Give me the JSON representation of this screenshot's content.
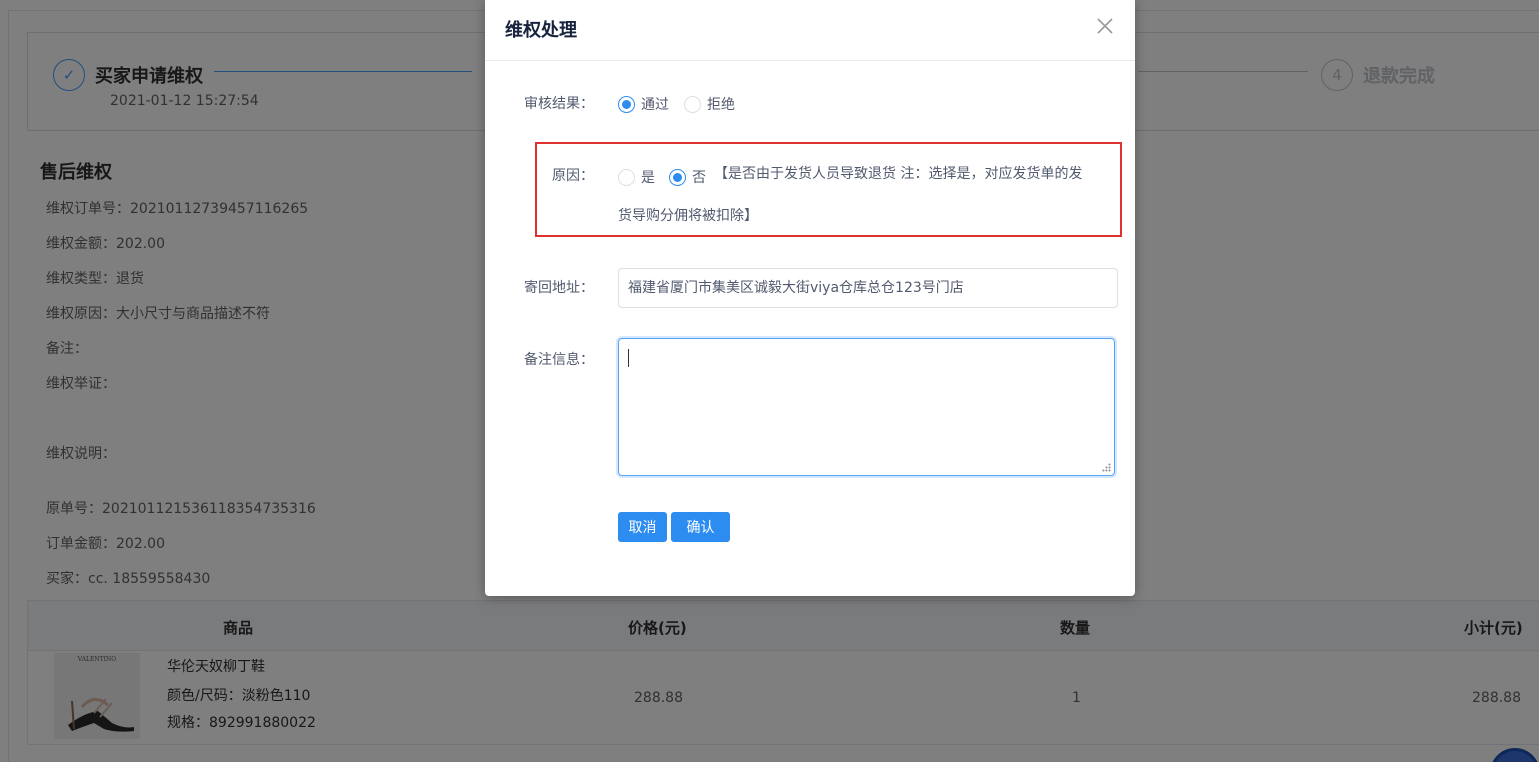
{
  "steps": [
    {
      "num": "✓",
      "title": "买家申请维权",
      "date": "2021-01-12 15:27:54",
      "state": "done"
    },
    {
      "num": "4",
      "title": "退款完成",
      "state": "wait"
    }
  ],
  "section_title": "售后维权",
  "info": {
    "order_no": "维权订单号：20210112739457116265",
    "amount": "维权金额：202.00",
    "type": "维权类型：退货",
    "reason": "维权原因：大小尺寸与商品描述不符",
    "remark": "备注：",
    "evidence": "维权举证：",
    "explain": "维权说明：",
    "orig_order": "原单号：20210112153611835473531​6",
    "order_amount": "订单金额：202.00",
    "buyer": "买家：cc. 18559558430"
  },
  "table": {
    "headers": {
      "goods": "商品",
      "price": "价格(元)",
      "qty": "数量",
      "subtotal": "小计(元)"
    },
    "row": {
      "name": "华伦天奴柳丁鞋",
      "spec_color": "颜色/尺码：淡粉色110",
      "spec_code": "规格：892991880022",
      "price": "288.88",
      "qty": "1",
      "subtotal": "288.88",
      "img_brand": "VALENTINO"
    }
  },
  "dialog": {
    "title": "维权处理",
    "audit_label": "审核结果：",
    "audit_options": [
      "通过",
      "拒绝"
    ],
    "audit_selected": "通过",
    "reason_label": "原因：",
    "reason_options": [
      "是",
      "否"
    ],
    "reason_selected": "否",
    "reason_note_1": "【是否由于发货人员导致退货 注：选择是，对应发货单的发",
    "reason_note_2": "货导购分佣将被扣除】",
    "address_label": "寄回地址：",
    "address_value": "福建省厦门市集美区诚毅大街viya仓库总仓123号门店",
    "remark_label": "备注信息：",
    "remark_value": "",
    "cancel_label": "取消",
    "confirm_label": "确认"
  },
  "colors": {
    "primary": "#2d8cf0",
    "highlight": "#e03131",
    "mask": "rgba(0,0,0,0.5)"
  }
}
